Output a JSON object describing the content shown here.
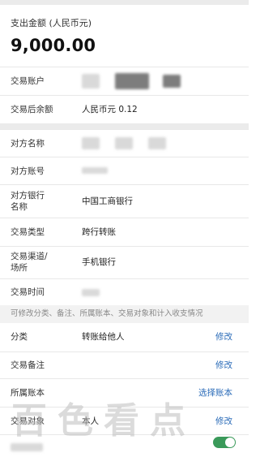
{
  "amount": {
    "label": "支出金额 (人民币元)",
    "value": "9,000.00"
  },
  "account_section": [
    {
      "key": "交易账户",
      "value": ""
    },
    {
      "key": "交易后余额",
      "value": "人民币元 0.12"
    }
  ],
  "counterparty_section": [
    {
      "key": "对方名称",
      "value": ""
    },
    {
      "key": "对方账号",
      "value": ""
    },
    {
      "key": "对方银行名称",
      "key_line1": "对方银行",
      "key_line2": "名称",
      "value": "中国工商银行"
    },
    {
      "key": "交易类型",
      "value": "跨行转账"
    },
    {
      "key": "交易渠道/场所",
      "key_line1": "交易渠道/",
      "key_line2": "场所",
      "value": "手机银行"
    },
    {
      "key": "交易时间",
      "value": ""
    }
  ],
  "hint": "可修改分类、备注、所属账本、交易对象和计入收支情况",
  "editable_section": [
    {
      "key": "分类",
      "value": "转账给他人",
      "action": "修改"
    },
    {
      "key": "交易备注",
      "value": "",
      "action": "修改"
    },
    {
      "key": "所属账本",
      "value": "",
      "action": "选择账本"
    },
    {
      "key": "交易对象",
      "value": "本人",
      "action": "修改"
    }
  ],
  "watermark": "百色看点",
  "colors": {
    "accent": "#2a6bb8",
    "toggle_on": "#3a9a5a",
    "divider": "#ebebeb"
  }
}
